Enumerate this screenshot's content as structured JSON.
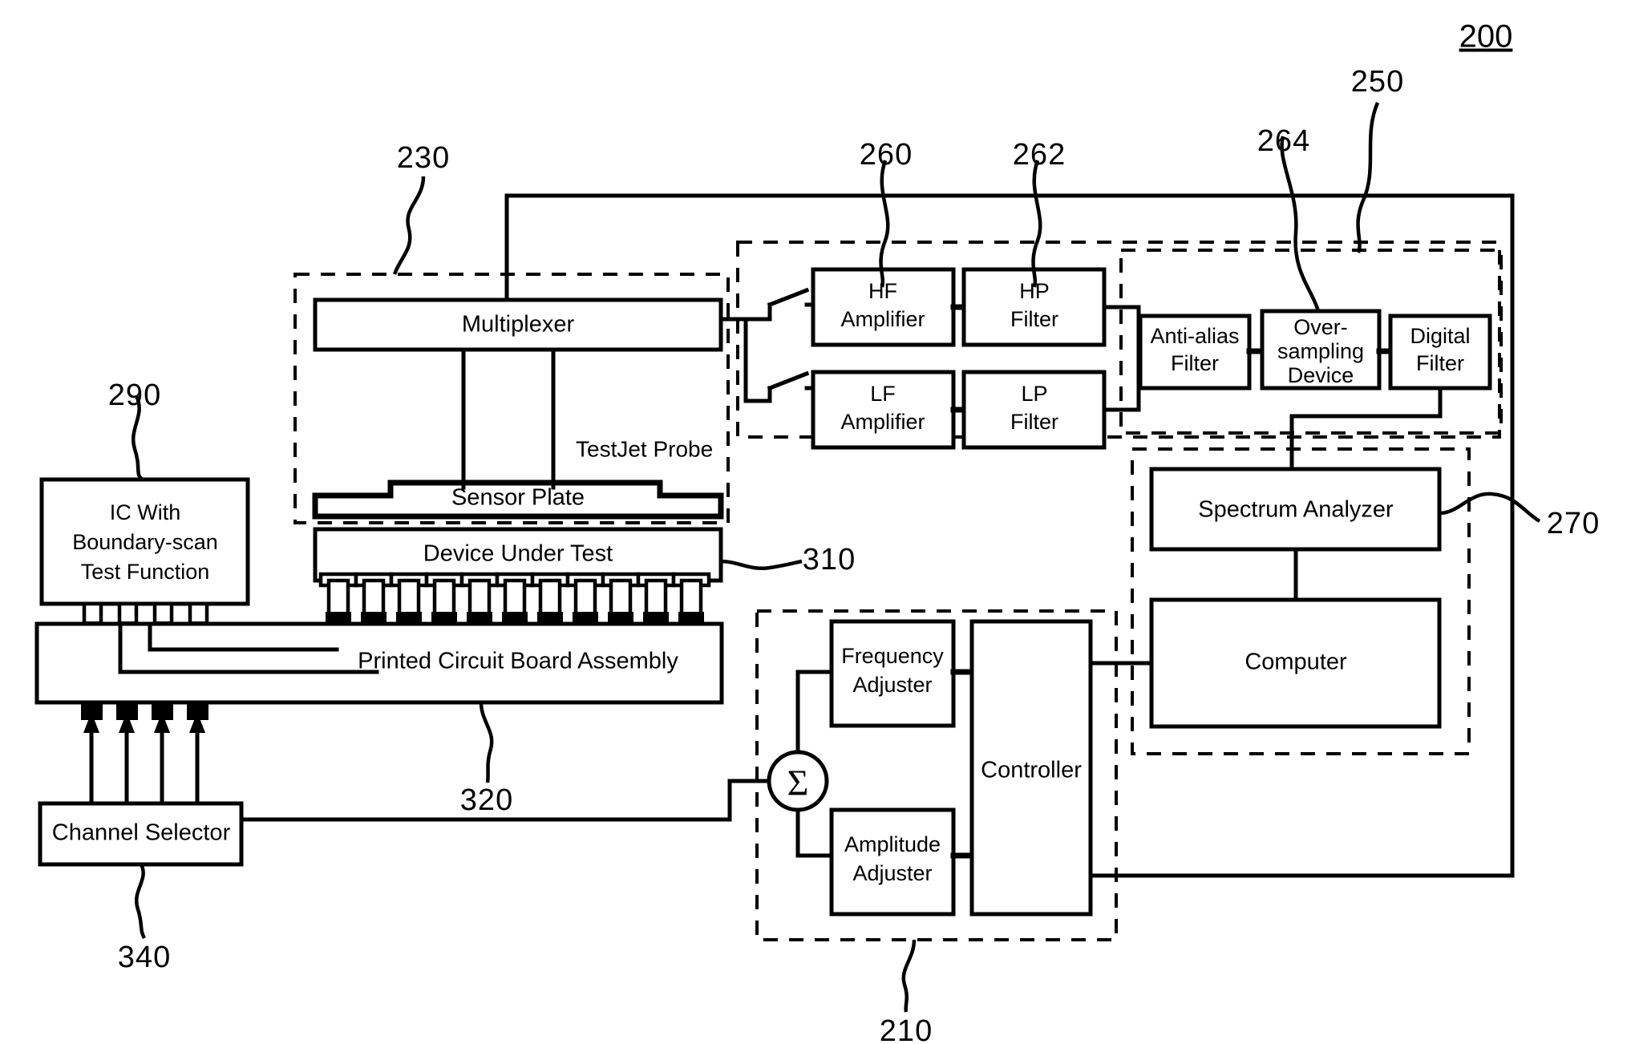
{
  "figure": {
    "main_ref": "200"
  },
  "reference_numbers": [
    {
      "id": "ref-200",
      "label": "200"
    },
    {
      "id": "ref-250",
      "label": "250"
    },
    {
      "id": "ref-230",
      "label": "230"
    },
    {
      "id": "ref-260",
      "label": "260"
    },
    {
      "id": "ref-262",
      "label": "262"
    },
    {
      "id": "ref-264",
      "label": "264"
    },
    {
      "id": "ref-270",
      "label": "270"
    },
    {
      "id": "ref-290",
      "label": "290"
    },
    {
      "id": "ref-310",
      "label": "310"
    },
    {
      "id": "ref-320",
      "label": "320"
    },
    {
      "id": "ref-340",
      "label": "340"
    },
    {
      "id": "ref-210",
      "label": "210"
    }
  ],
  "blocks": {
    "multiplexer": "Multiplexer",
    "sensor_plate": "Sensor Plate",
    "testjet_probe": "TestJet Probe",
    "hf_amplifier_line1": "HF",
    "hf_amplifier_line2": "Amplifier",
    "hp_filter_line1": "HP",
    "hp_filter_line2": "Filter",
    "lf_amplifier_line1": "LF",
    "lf_amplifier_line2": "Amplifier",
    "lp_filter_line1": "LP",
    "lp_filter_line2": "Filter",
    "antialias_line1": "Anti-alias",
    "antialias_line2": "Filter",
    "oversampling_line1": "Over-",
    "oversampling_line2": "sampling",
    "oversampling_line3": "Device",
    "digital_filter_line1": "Digital",
    "digital_filter_line2": "Filter",
    "spectrum_analyzer": "Spectrum Analyzer",
    "computer": "Computer",
    "ic_line1": "IC With",
    "ic_line2": "Boundary-scan",
    "ic_line3": "Test  Function",
    "device_under_test": "Device Under Test",
    "pcb_assembly": "Printed Circuit Board  Assembly",
    "channel_selector": "Channel Selector",
    "frequency_adjuster_line1": "Frequency",
    "frequency_adjuster_line2": "Adjuster",
    "amplitude_adjuster_line1": "Amplitude",
    "amplitude_adjuster_line2": "Adjuster",
    "controller": "Controller",
    "summer_symbol": "Σ"
  },
  "colors": {
    "stroke": "#000000",
    "fill": "#ffffff"
  }
}
